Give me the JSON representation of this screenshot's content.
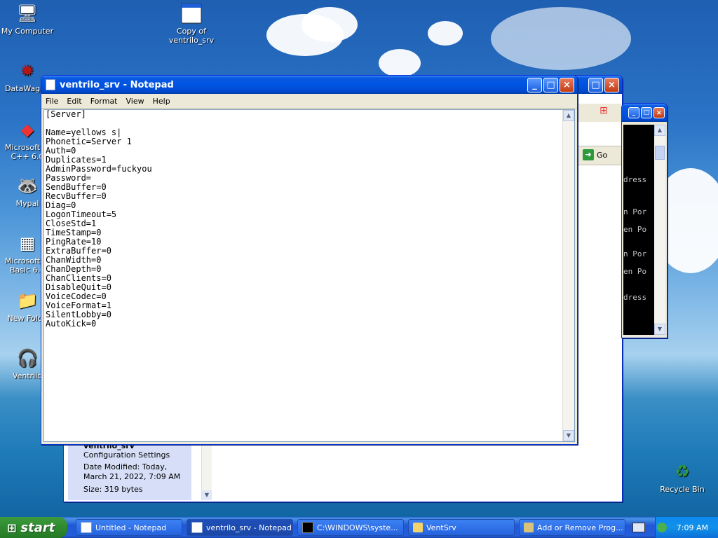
{
  "desktop": {
    "icons": [
      {
        "label": "My Computer"
      },
      {
        "label": "DataWagon"
      },
      {
        "label": "Microsoft Vi C++ 6.0"
      },
      {
        "label": "Mypal"
      },
      {
        "label": "Microsoft Vi Basic 6.0"
      },
      {
        "label": "New Folde"
      },
      {
        "label": "Ventrilo"
      },
      {
        "label": "Copy of ventrilo_srv"
      },
      {
        "label": "Recycle Bin"
      }
    ]
  },
  "explorer": {
    "go_label": "Go",
    "details": {
      "name": "ventrilo_srv",
      "type": "Configuration Settings",
      "date_modified": "Date Modified: Today, March 21, 2022, 7:09 AM",
      "size": "Size: 319 bytes"
    }
  },
  "cmd": {
    "lines": [
      "dress",
      "n Por",
      "en Po",
      "n Por",
      "en Po",
      "dress"
    ]
  },
  "notepad": {
    "title": "ventrilo_srv - Notepad",
    "menu": [
      "File",
      "Edit",
      "Format",
      "View",
      "Help"
    ],
    "text": "[Server]\n\nName=yellows s|\nPhonetic=Server 1\nAuth=0\nDuplicates=1\nAdminPassword=fuckyou\nPassword=\nSendBuffer=0\nRecvBuffer=0\nDiag=0\nLogonTimeout=5\nCloseStd=1\nTimeStamp=0\nPingRate=10\nExtraBuffer=0\nChanWidth=0\nChanDepth=0\nChanClients=0\nDisableQuit=0\nVoiceCodec=0\nVoiceFormat=1\nSilentLobby=0\nAutoKick=0"
  },
  "taskbar": {
    "start_label": "start",
    "tasks": [
      {
        "label": "Untitled - Notepad"
      },
      {
        "label": "ventrilo_srv - Notepad"
      },
      {
        "label": "C:\\WINDOWS\\syste..."
      },
      {
        "label": "VentSrv"
      },
      {
        "label": "Add or Remove Prog..."
      }
    ],
    "clock": "7:09 AM"
  },
  "colors": {
    "titlebar": "#0054e3",
    "start_green": "#2f8a2f",
    "taskbar": "#245edb"
  }
}
